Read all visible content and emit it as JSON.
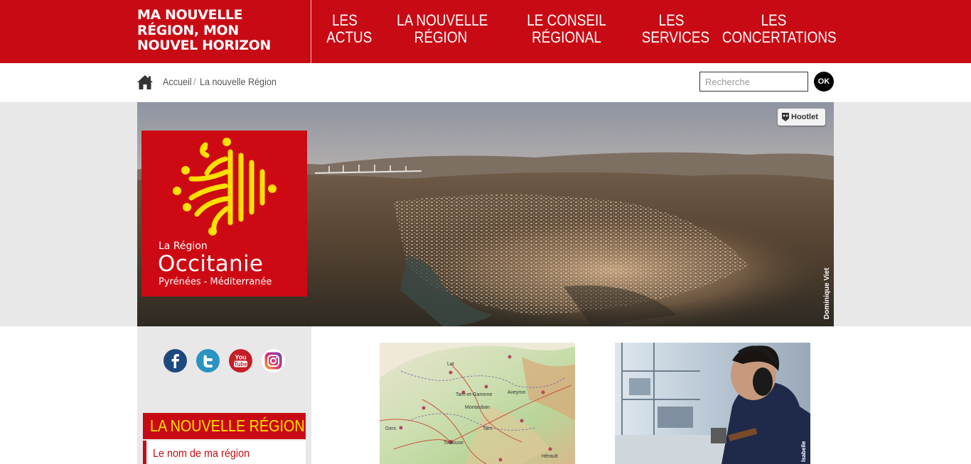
{
  "header": {
    "brand_lines": [
      "MA NOUVELLE",
      "RÉGION, MON",
      "NOUVEL HORIZON"
    ],
    "nav": [
      {
        "line1": "LES",
        "line2": "ACTUS"
      },
      {
        "line1": "LA NOUVELLE",
        "line2": "RÉGION"
      },
      {
        "line1": "LE CONSEIL",
        "line2": "RÉGIONAL"
      },
      {
        "line1": "LES",
        "line2": "SERVICES"
      },
      {
        "line1": "LES",
        "line2": "CONCERTATIONS"
      }
    ]
  },
  "breadcrumb": {
    "home_icon": "home-icon",
    "items": [
      "Accueil",
      "La nouvelle Région"
    ],
    "separator": "/"
  },
  "search": {
    "placeholder": "Recherche",
    "value": "",
    "button_label": "OK"
  },
  "banner": {
    "logo": {
      "line_small": "La Région",
      "line_big": "Occitanie",
      "line_sub": "Pyrénées - Méditerranée",
      "cross_color": "#ffe100",
      "box_color": "#cd0a14"
    },
    "hootlet_label": "Hootlet",
    "photo_credit": "Dominique Viet"
  },
  "sidebar": {
    "social_icons": [
      "facebook-icon",
      "twitter-icon",
      "youtube-icon",
      "instagram-icon"
    ],
    "youtube_text": [
      "You",
      "Tube"
    ],
    "section_title": "LA NOUVELLE RÉGION",
    "menu": [
      {
        "label": "Le nom de ma région"
      }
    ]
  },
  "cards": {
    "map_labels": [
      "Lot",
      "Aveyron",
      "Tarn-et-Garonne",
      "Montauban",
      "Tarn",
      "Gers",
      "Toulouse",
      "Hérault"
    ],
    "photo_credit": "Isabelle"
  },
  "colors": {
    "brand_red": "#c80a14",
    "accent_yellow": "#ffe100",
    "sidebar_gray": "#e8e8e8",
    "facebook": "#1d4a7e",
    "twitter": "#2a93c4",
    "youtube": "#c41e27"
  }
}
